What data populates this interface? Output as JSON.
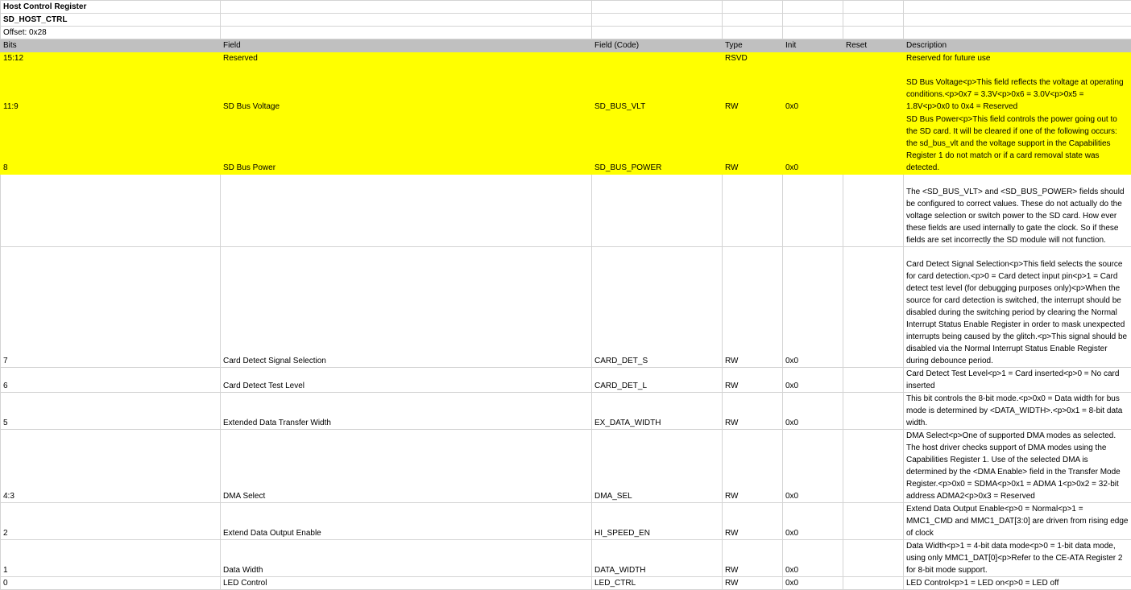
{
  "register": {
    "title": "Host Control Register",
    "name": "SD_HOST_CTRL",
    "offset": "Offset: 0x28"
  },
  "columns": {
    "bits": "Bits",
    "field": "Field",
    "code": "Field (Code)",
    "type": "Type",
    "init": "Init",
    "reset": "Reset",
    "description": "Description"
  },
  "rows": [
    {
      "bits": "15:12",
      "field": "Reserved",
      "code": "",
      "type": "RSVD",
      "init": "",
      "reset": "",
      "description": "Reserved for future use"
    },
    {
      "bits": "11:9",
      "field": "SD Bus Voltage",
      "code": "SD_BUS_VLT",
      "type": "RW",
      "init": "0x0",
      "reset": "",
      "description": "SD Bus Voltage<p>This field reflects the voltage at operating conditions.<p>0x7 = 3.3V<p>0x6 = 3.0V<p>0x5 = 1.8V<p>0x0 to 0x4 = Reserved"
    },
    {
      "bits": "8",
      "field": "SD Bus Power",
      "code": "SD_BUS_POWER",
      "type": "RW",
      "init": "0x0",
      "reset": "",
      "description": "SD Bus Power<p>This field controls the power going out to the SD card. It will be cleared if one of the following occurs: the sd_bus_vlt and the voltage support in the Capabilities Register 1 do not match or if a card removal state was detected."
    },
    {
      "bits": "",
      "field": "",
      "code": "",
      "type": "",
      "init": "",
      "reset": "",
      "description": "The <SD_BUS_VLT> and <SD_BUS_POWER> fields should be configured to correct values. These do not actually do the voltage selection or switch power to the SD card. How ever these fields are used internally to gate the clock. So if these fields are set incorrectly the SD module will not function."
    },
    {
      "bits": "7",
      "field": "Card Detect Signal Selection",
      "code": "CARD_DET_S",
      "type": "RW",
      "init": "0x0",
      "reset": "",
      "description": "Card Detect Signal Selection<p>This field selects the source for card detection.<p>0 = Card detect input pin<p>1 = Card detect test level (for debugging purposes only)<p>When the source for card detection is switched, the interrupt should be disabled during the switching period by clearing the Normal Interrupt Status Enable Register in order to mask unexpected interrupts being caused by the glitch.<p>This signal should be disabled via the Normal Interrupt Status Enable Register during debounce period."
    },
    {
      "bits": "6",
      "field": "Card Detect Test Level",
      "code": "CARD_DET_L",
      "type": "RW",
      "init": "0x0",
      "reset": "",
      "description": "Card Detect Test Level<p>1 = Card inserted<p>0 = No card inserted"
    },
    {
      "bits": "5",
      "field": "Extended Data Transfer Width",
      "code": "EX_DATA_WIDTH",
      "type": "RW",
      "init": "0x0",
      "reset": "",
      "description": "This bit controls the 8-bit mode.<p>0x0 = Data width for bus mode is determined by <DATA_WIDTH>.<p>0x1 = 8-bit data width."
    },
    {
      "bits": "4:3",
      "field": "DMA Select",
      "code": "DMA_SEL",
      "type": "RW",
      "init": "0x0",
      "reset": "",
      "description": "DMA Select<p>One of supported DMA modes as selected. The host driver checks support of DMA modes using the Capabilities Register 1. Use of the selected DMA is determined by the <DMA Enable> field in the Transfer Mode Register.<p>0x0 = SDMA<p>0x1 = ADMA 1<p>0x2 = 32-bit address ADMA2<p>0x3 = Reserved"
    },
    {
      "bits": "2",
      "field": "Extend Data Output Enable",
      "code": "HI_SPEED_EN",
      "type": "RW",
      "init": "0x0",
      "reset": "",
      "description": "Extend Data Output Enable<p>0 = Normal<p>1 = MMC1_CMD and MMC1_DAT[3:0] are driven from rising edge of clock"
    },
    {
      "bits": "1",
      "field": "Data Width",
      "code": "DATA_WIDTH",
      "type": "RW",
      "init": "0x0",
      "reset": "",
      "description": "Data Width<p>1 = 4-bit data mode<p>0 = 1-bit data mode, using only MMC1_DAT[0]<p>Refer to the CE-ATA Register 2 for 8-bit mode support."
    },
    {
      "bits": "0",
      "field": "LED Control",
      "code": "LED_CTRL",
      "type": "RW",
      "init": "0x0",
      "reset": "",
      "description": "LED Control<p>1 = LED on<p>0 = LED off"
    }
  ]
}
